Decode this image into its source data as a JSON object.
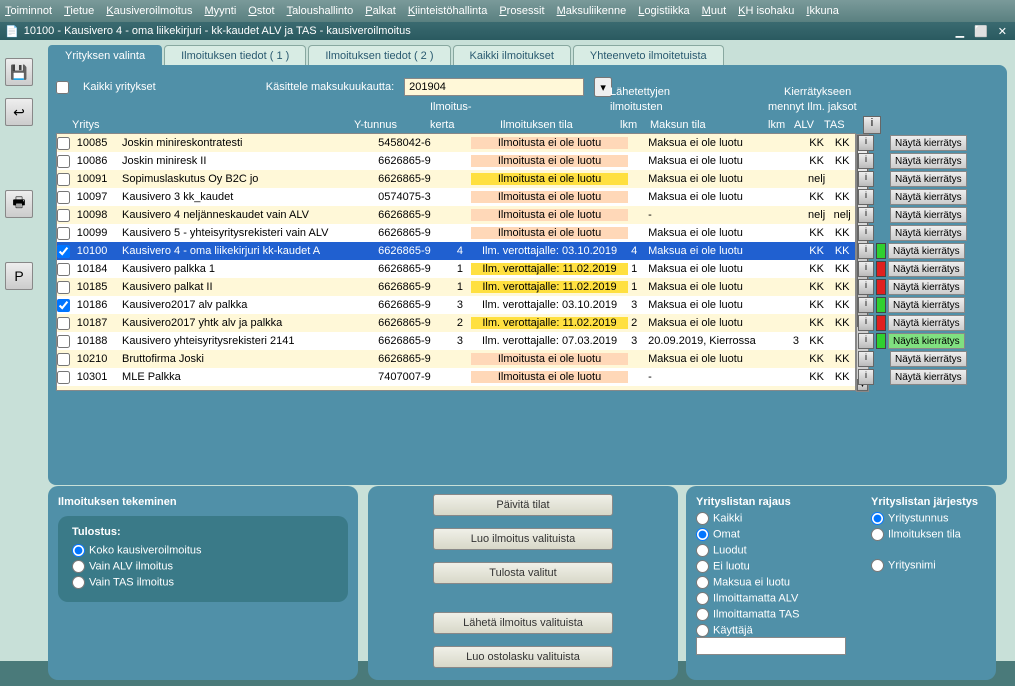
{
  "menu": [
    "Toiminnot",
    "Tietue",
    "Kausiveroilmoitus",
    "Myynti",
    "Ostot",
    "Taloushallinto",
    "Palkat",
    "Kiinteistöhallinta",
    "Prosessit",
    "Maksuliikenne",
    "Logistiikka",
    "Muut",
    "KH isohaku",
    "Ikkuna"
  ],
  "window_title": "10100 - Kausivero 4 - oma liikekirjuri - kk-kaudet ALV ja TAS - kausiveroilmoitus",
  "tabs": [
    "Yrityksen valinta",
    "Ilmoituksen tiedot ( 1 )",
    "Ilmoituksen tiedot ( 2 )",
    "Kaikki ilmoitukset",
    "Yhteenveto ilmoitetuista"
  ],
  "filter": {
    "kaikki_label": "Kaikki yritykset",
    "kasittele_label": "Käsittele maksukuukautta:",
    "kk_value": "201904"
  },
  "headers": {
    "yritys": "Yritys",
    "ytunnus": "Y-tunnus",
    "ilmoituskerta1": "Ilmoitus-",
    "ilmoituskerta2": "kerta",
    "tila": "Ilmoituksen tila",
    "lahet1": "Lähetettyjen",
    "lahet2": "ilmoitusten",
    "lahet3": "lkm",
    "maksu": "Maksun tila",
    "kier1": "Kierrätykseen",
    "kier2": "mennyt Ilm. jaksot",
    "lkm": "lkm",
    "alv": "ALV",
    "tas": "TAS"
  },
  "rows": [
    {
      "cb": false,
      "id": "10085",
      "name": "Joskin minireskontratesti",
      "yt": "5458042-6",
      "kerta": "",
      "tila": "Ilmoitusta ei ole luotu",
      "tilac": "peach",
      "lkm": "",
      "maksu": "Maksua ei ole luotu",
      "mlkm": "",
      "alv": "KK",
      "tas": "KK",
      "status": ""
    },
    {
      "cb": false,
      "id": "10086",
      "name": "Joskin miniresk II",
      "yt": "6626865-9",
      "kerta": "",
      "tila": "Ilmoitusta ei ole luotu",
      "tilac": "peach",
      "lkm": "",
      "maksu": "Maksua ei ole luotu",
      "mlkm": "",
      "alv": "KK",
      "tas": "KK",
      "status": ""
    },
    {
      "cb": false,
      "id": "10091",
      "name": "Sopimuslaskutus Oy B2C jo",
      "yt": "6626865-9",
      "kerta": "",
      "tila": "Ilmoitusta ei ole luotu",
      "tilac": "yellow",
      "lkm": "",
      "maksu": "Maksua ei ole luotu",
      "mlkm": "",
      "alv": "nelj",
      "tas": "",
      "status": ""
    },
    {
      "cb": false,
      "id": "10097",
      "name": "Kausivero 3 kk_kaudet",
      "yt": "0574075-3",
      "kerta": "",
      "tila": "Ilmoitusta ei ole luotu",
      "tilac": "peach",
      "lkm": "",
      "maksu": "Maksua ei ole luotu",
      "mlkm": "",
      "alv": "KK",
      "tas": "KK",
      "status": ""
    },
    {
      "cb": false,
      "id": "10098",
      "name": "Kausivero 4 neljänneskaudet vain ALV",
      "yt": "6626865-9",
      "kerta": "",
      "tila": "Ilmoitusta ei ole luotu",
      "tilac": "peach",
      "lkm": "",
      "maksu": "-",
      "mlkm": "",
      "alv": "nelj",
      "tas": "nelj",
      "status": ""
    },
    {
      "cb": false,
      "id": "10099",
      "name": "Kausivero 5 - yhteisyritysrekisteri vain ALV",
      "yt": "6626865-9",
      "kerta": "",
      "tila": "Ilmoitusta ei ole luotu",
      "tilac": "peach",
      "lkm": "",
      "maksu": "Maksua ei ole luotu",
      "mlkm": "",
      "alv": "KK",
      "tas": "KK",
      "status": ""
    },
    {
      "cb": true,
      "id": "10100",
      "name": "Kausivero 4 - oma liikekirjuri kk-kaudet A",
      "yt": "6626865-9",
      "kerta": "4",
      "tila": "Ilm. verottajalle: 03.10.2019",
      "tilac": "",
      "lkm": "4",
      "maksu": "Maksua ei ole luotu",
      "mlkm": "",
      "alv": "KK",
      "tas": "KK",
      "status": "green",
      "selected": true
    },
    {
      "cb": false,
      "id": "10184",
      "name": "Kausivero palkka 1",
      "yt": "6626865-9",
      "kerta": "1",
      "tila": "Ilm. verottajalle: 11.02.2019",
      "tilac": "yellow",
      "lkm": "1",
      "maksu": "Maksua ei ole luotu",
      "mlkm": "",
      "alv": "KK",
      "tas": "KK",
      "status": "red"
    },
    {
      "cb": false,
      "id": "10185",
      "name": "Kausivero palkat II",
      "yt": "6626865-9",
      "kerta": "1",
      "tila": "Ilm. verottajalle: 11.02.2019",
      "tilac": "yellow",
      "lkm": "1",
      "maksu": "Maksua ei ole luotu",
      "mlkm": "",
      "alv": "KK",
      "tas": "KK",
      "status": "red"
    },
    {
      "cb": true,
      "id": "10186",
      "name": "Kausivero2017 alv palkka",
      "yt": "6626865-9",
      "kerta": "3",
      "tila": "Ilm. verottajalle: 03.10.2019",
      "tilac": "",
      "lkm": "3",
      "maksu": "Maksua ei ole luotu",
      "mlkm": "",
      "alv": "KK",
      "tas": "KK",
      "status": "green"
    },
    {
      "cb": false,
      "id": "10187",
      "name": "Kausivero2017 yhtk alv ja palkka",
      "yt": "6626865-9",
      "kerta": "2",
      "tila": "Ilm. verottajalle: 11.02.2019",
      "tilac": "yellow",
      "lkm": "2",
      "maksu": "Maksua ei ole luotu",
      "mlkm": "",
      "alv": "KK",
      "tas": "KK",
      "status": "red"
    },
    {
      "cb": false,
      "id": "10188",
      "name": "Kausivero yhteisyritysrekisteri 2141",
      "yt": "6626865-9",
      "kerta": "3",
      "tila": "Ilm. verottajalle: 07.03.2019",
      "tilac": "",
      "lkm": "3",
      "maksu": "20.09.2019, Kierrossa",
      "mlkm": "3",
      "alv": "KK",
      "tas": "",
      "status": "green",
      "nbtn_green": true
    },
    {
      "cb": false,
      "id": "10210",
      "name": "Bruttofirma Joski",
      "yt": "6626865-9",
      "kerta": "",
      "tila": "Ilmoitusta ei ole luotu",
      "tilac": "peach",
      "lkm": "",
      "maksu": "Maksua ei ole luotu",
      "mlkm": "",
      "alv": "KK",
      "tas": "KK",
      "status": ""
    },
    {
      "cb": false,
      "id": "10301",
      "name": "MLE Palkka",
      "yt": "7407007-9",
      "kerta": "",
      "tila": "Ilmoitusta ei ole luotu",
      "tilac": "peach",
      "lkm": "",
      "maksu": "-",
      "mlkm": "",
      "alv": "KK",
      "tas": "KK",
      "status": ""
    }
  ],
  "btn_nayta": "Näytä kierrätys",
  "section_ilm": "Ilmoituksen tekeminen",
  "section_tulostus": "Tulostus:",
  "radio_print": [
    "Koko kausiveroilmoitus",
    "Vain ALV ilmoitus",
    "Vain TAS ilmoitus"
  ],
  "actions": {
    "paivita": "Päivitä tilat",
    "luo_ilm": "Luo ilmoitus valituista",
    "tulosta": "Tulosta valitut",
    "laheta": "Lähetä ilmoitus valituista",
    "luo_osto": "Luo ostolasku valituista"
  },
  "rajaus": {
    "title": "Yrityslistan rajaus",
    "items": [
      "Kaikki",
      "Omat",
      "Luodut",
      "Ei luotu",
      "Maksua ei luotu",
      "Ilmoittamatta ALV",
      "Ilmoittamatta TAS",
      "Käyttäjä"
    ]
  },
  "jarjestys": {
    "title": "Yrityslistan järjestys",
    "items": [
      "Yritystunnus",
      "Ilmoituksen tila",
      "Yritysnimi"
    ]
  },
  "i": "i"
}
